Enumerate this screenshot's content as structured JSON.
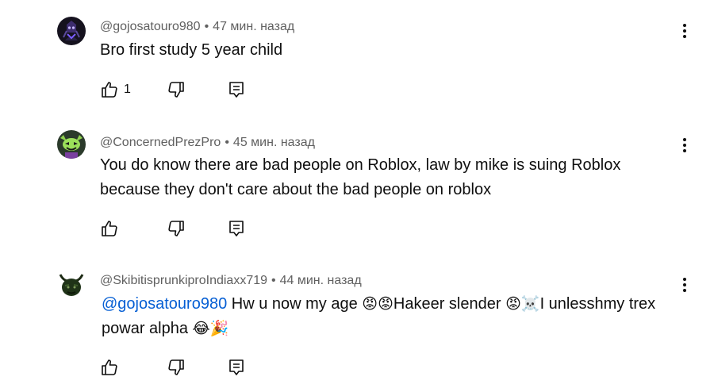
{
  "comments": [
    {
      "author": "@gojosatouro980",
      "separator": "•",
      "time": "47 мин. назад",
      "text": "Bro first study 5 year child",
      "likes": "1",
      "avatar_icon": "dark-character-avatar"
    },
    {
      "author": "@ConcernedPrezPro",
      "separator": "•",
      "time": "45 мин. назад",
      "text": "You do know there are bad people on Roblox, law by mike is suing Roblox because they don't care about the bad people on roblox",
      "likes": "",
      "avatar_icon": "green-creature-avatar"
    },
    {
      "author": "@SkibitisprunkiproIndiaxx719",
      "separator": "•",
      "time": "44 мин. назад",
      "mention": "@gojosatouro980",
      "text_part1": " Hw u now my age ",
      "emoji1": "😡😡",
      "text_part2": "Hakeer slender ",
      "emoji2": "😡☠️",
      "text_part3": "I unlesshmy trex powar alpha ",
      "emoji3": "😂🎉",
      "likes": "",
      "avatar_icon": "horned-creature-avatar"
    }
  ],
  "colors": {
    "meta": "#606060",
    "text": "#0f0f0f",
    "mention": "#065fd4"
  }
}
